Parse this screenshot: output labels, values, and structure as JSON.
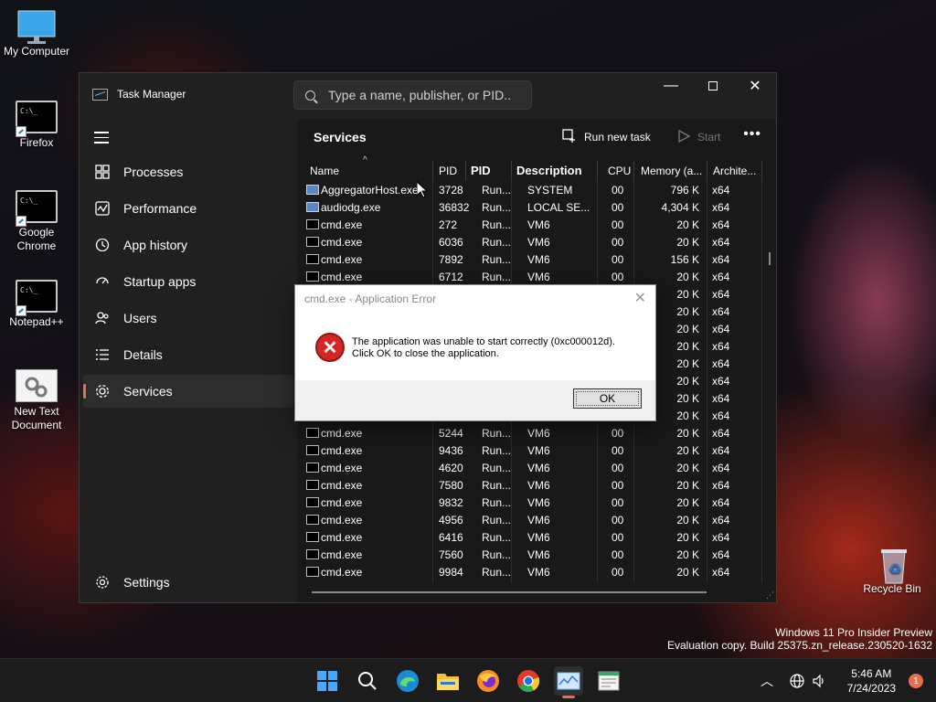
{
  "desktop": {
    "icons": [
      {
        "label": "My Computer",
        "glyph": "monitor-icon"
      },
      {
        "label": "Firefox",
        "glyph": "cmd-icon"
      },
      {
        "label": "Google Chrome",
        "glyph": "cmd-icon"
      },
      {
        "label": "Notepad++",
        "glyph": "cmd-icon"
      },
      {
        "label": "New Text Document",
        "glyph": "settings-file-icon"
      },
      {
        "label": "Recycle Bin",
        "glyph": "recycle-bin-icon"
      }
    ],
    "watermark": {
      "line1": "Windows 11 Pro Insider Preview",
      "line2": "Evaluation copy. Build 25375.zn_release.230520-1632"
    }
  },
  "task_manager": {
    "title": "Task Manager",
    "search_placeholder": "Type a name, publisher, or PID...",
    "page_title": "Services",
    "run_new_task": "Run new task",
    "start": "Start",
    "more": "•••",
    "nav": [
      {
        "label": "Processes",
        "icon": "processes-icon"
      },
      {
        "label": "Performance",
        "icon": "performance-icon"
      },
      {
        "label": "App history",
        "icon": "app-history-icon"
      },
      {
        "label": "Startup apps",
        "icon": "startup-apps-icon"
      },
      {
        "label": "Users",
        "icon": "users-icon"
      },
      {
        "label": "Details",
        "icon": "details-icon"
      },
      {
        "label": "Services",
        "icon": "services-icon",
        "active": true
      }
    ],
    "settings": "Settings",
    "columns": [
      "Name",
      "PID",
      "PID",
      "Description",
      "CPU",
      "Memory (a...",
      "Archite..."
    ],
    "rows": [
      {
        "name": "AggregatorHost.exe",
        "pid": "3728",
        "status": "Run...",
        "user": "SYSTEM",
        "cpu": "00",
        "mem": "796 K",
        "arch": "x64"
      },
      {
        "name": "audiodg.exe",
        "pid": "36832",
        "status": "Run...",
        "user": "LOCAL SE...",
        "cpu": "00",
        "mem": "4,304 K",
        "arch": "x64"
      },
      {
        "name": "cmd.exe",
        "pid": "272",
        "status": "Run...",
        "user": "VM6",
        "cpu": "00",
        "mem": "20 K",
        "arch": "x64"
      },
      {
        "name": "cmd.exe",
        "pid": "6036",
        "status": "Run...",
        "user": "VM6",
        "cpu": "00",
        "mem": "20 K",
        "arch": "x64"
      },
      {
        "name": "cmd.exe",
        "pid": "7892",
        "status": "Run...",
        "user": "VM6",
        "cpu": "00",
        "mem": "156 K",
        "arch": "x64"
      },
      {
        "name": "cmd.exe",
        "pid": "6712",
        "status": "Run...",
        "user": "VM6",
        "cpu": "00",
        "mem": "20 K",
        "arch": "x64"
      },
      {
        "name": "",
        "pid": "",
        "status": "",
        "user": "",
        "cpu": "00",
        "mem": "20 K",
        "arch": "x64"
      },
      {
        "name": "",
        "pid": "",
        "status": "",
        "user": "",
        "cpu": "00",
        "mem": "20 K",
        "arch": "x64"
      },
      {
        "name": "",
        "pid": "",
        "status": "",
        "user": "",
        "cpu": "00",
        "mem": "20 K",
        "arch": "x64"
      },
      {
        "name": "",
        "pid": "",
        "status": "",
        "user": "",
        "cpu": "00",
        "mem": "20 K",
        "arch": "x64"
      },
      {
        "name": "",
        "pid": "",
        "status": "",
        "user": "",
        "cpu": "00",
        "mem": "20 K",
        "arch": "x64"
      },
      {
        "name": "",
        "pid": "",
        "status": "",
        "user": "",
        "cpu": "00",
        "mem": "20 K",
        "arch": "x64"
      },
      {
        "name": "",
        "pid": "",
        "status": "",
        "user": "",
        "cpu": "00",
        "mem": "20 K",
        "arch": "x64"
      },
      {
        "name": "",
        "pid": "",
        "status": "",
        "user": "",
        "cpu": "00",
        "mem": "20 K",
        "arch": "x64"
      },
      {
        "name": "cmd.exe",
        "pid": "5244",
        "status": "Run...",
        "user": "VM6",
        "cpu": "00",
        "mem": "20 K",
        "arch": "x64"
      },
      {
        "name": "cmd.exe",
        "pid": "9436",
        "status": "Run...",
        "user": "VM6",
        "cpu": "00",
        "mem": "20 K",
        "arch": "x64"
      },
      {
        "name": "cmd.exe",
        "pid": "4620",
        "status": "Run...",
        "user": "VM6",
        "cpu": "00",
        "mem": "20 K",
        "arch": "x64"
      },
      {
        "name": "cmd.exe",
        "pid": "7580",
        "status": "Run...",
        "user": "VM6",
        "cpu": "00",
        "mem": "20 K",
        "arch": "x64"
      },
      {
        "name": "cmd.exe",
        "pid": "9832",
        "status": "Run...",
        "user": "VM6",
        "cpu": "00",
        "mem": "20 K",
        "arch": "x64"
      },
      {
        "name": "cmd.exe",
        "pid": "4956",
        "status": "Run...",
        "user": "VM6",
        "cpu": "00",
        "mem": "20 K",
        "arch": "x64"
      },
      {
        "name": "cmd.exe",
        "pid": "6416",
        "status": "Run...",
        "user": "VM6",
        "cpu": "00",
        "mem": "20 K",
        "arch": "x64"
      },
      {
        "name": "cmd.exe",
        "pid": "7560",
        "status": "Run...",
        "user": "VM6",
        "cpu": "00",
        "mem": "20 K",
        "arch": "x64"
      },
      {
        "name": "cmd.exe",
        "pid": "9984",
        "status": "Run...",
        "user": "VM6",
        "cpu": "00",
        "mem": "20 K",
        "arch": "x64"
      }
    ]
  },
  "dialog": {
    "title": "cmd.exe - Application Error",
    "line1": "The application was unable to start correctly (0xc000012d).",
    "line2": "Click OK to close the application.",
    "ok": "OK",
    "close": "✕"
  },
  "taskbar": {
    "time": "5:46 AM",
    "date": "7/24/2023",
    "notification_count": "1",
    "apps": [
      "start-icon",
      "search-icon",
      "edge-icon",
      "file-explorer-icon",
      "firefox-icon",
      "chrome-icon",
      "task-manager-icon",
      "notepad-icon"
    ]
  },
  "colors": {
    "accent": "#e66f4f",
    "windows_blue": "#49a6ff",
    "error_red": "#d52626"
  }
}
